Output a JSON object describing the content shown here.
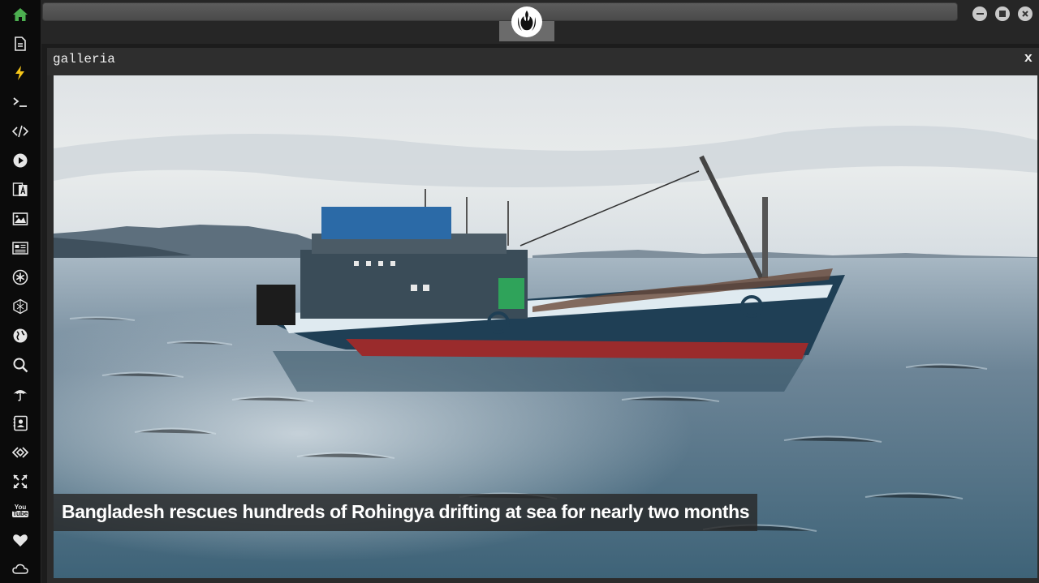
{
  "dock": {
    "items": [
      {
        "name": "home-icon",
        "active": true
      },
      {
        "name": "document-icon"
      },
      {
        "name": "lightning-icon"
      },
      {
        "name": "terminal-icon"
      },
      {
        "name": "code-icon"
      },
      {
        "name": "play-icon"
      },
      {
        "name": "translate-icon"
      },
      {
        "name": "image-icon"
      },
      {
        "name": "newspaper-icon"
      },
      {
        "name": "asterisk-icon"
      },
      {
        "name": "hexagon-icon"
      },
      {
        "name": "globe-icon"
      },
      {
        "name": "search-icon"
      },
      {
        "name": "umbrella-icon"
      },
      {
        "name": "contact-icon"
      },
      {
        "name": "dev-icon"
      },
      {
        "name": "expand-icon"
      },
      {
        "name": "youtube-icon",
        "label_top": "You",
        "label_bottom": "Tube"
      },
      {
        "name": "heart-icon"
      },
      {
        "name": "cloud-icon"
      }
    ],
    "active_color": "#4caf50",
    "lightning_color": "#f5c518"
  },
  "window": {
    "title": "galleria",
    "close_label": "x"
  },
  "gallery": {
    "caption": "Bangladesh rescues hundreds of Rohingya drifting at sea for nearly two months"
  },
  "window_controls": [
    "minimize-icon",
    "maximize-icon",
    "close-icon"
  ]
}
